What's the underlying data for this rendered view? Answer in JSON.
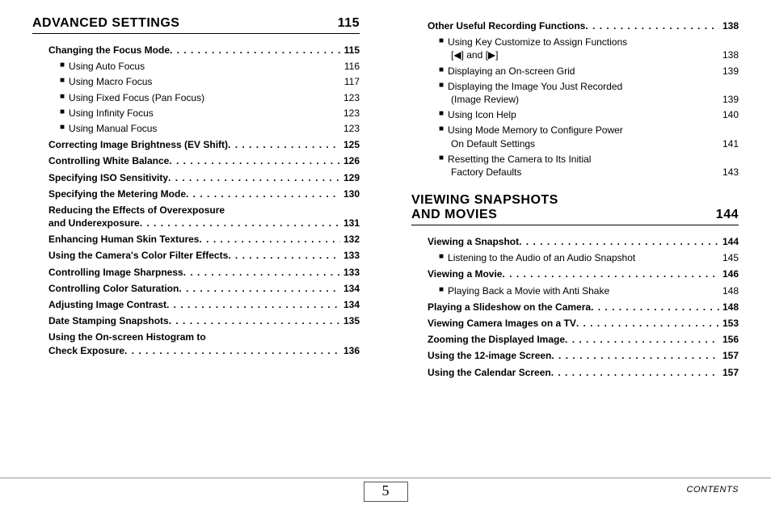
{
  "footer": {
    "page": "5",
    "label": "CONTENTS"
  },
  "left": {
    "heading": "ADVANCED SETTINGS",
    "heading_page": "115",
    "items": [
      {
        "t": 1,
        "title": "Changing the Focus Mode",
        "pg": "115"
      },
      {
        "t": 2,
        "title": "Using Auto Focus",
        "pg": "116"
      },
      {
        "t": 2,
        "title": "Using Macro Focus",
        "pg": "117"
      },
      {
        "t": 2,
        "title": "Using Fixed Focus (Pan Focus)",
        "pg": "123"
      },
      {
        "t": 2,
        "title": "Using Infinity Focus",
        "pg": "123"
      },
      {
        "t": 2,
        "title": "Using Manual Focus",
        "pg": "123"
      },
      {
        "t": 1,
        "title": "Correcting Image Brightness (EV Shift)",
        "pg": "125"
      },
      {
        "t": 1,
        "title": "Controlling White Balance",
        "pg": "126"
      },
      {
        "t": 1,
        "title": "Specifying ISO Sensitivity",
        "pg": "129"
      },
      {
        "t": 1,
        "title": "Specifying the Metering Mode",
        "pg": "130"
      },
      {
        "t": 1,
        "wrap": true,
        "title1": "Reducing the Effects of Overexposure",
        "title2": "and Underexposure",
        "pg": "131"
      },
      {
        "t": 1,
        "title": "Enhancing Human Skin Textures",
        "pg": "132"
      },
      {
        "t": 1,
        "title": "Using the Camera's Color Filter Effects",
        "pg": "133"
      },
      {
        "t": 1,
        "title": "Controlling Image Sharpness",
        "pg": "133"
      },
      {
        "t": 1,
        "title": "Controlling Color Saturation",
        "pg": "134"
      },
      {
        "t": 1,
        "title": "Adjusting Image Contrast",
        "pg": "134"
      },
      {
        "t": 1,
        "title": "Date Stamping Snapshots",
        "pg": "135"
      },
      {
        "t": 1,
        "wrap": true,
        "title1": "Using the On-screen Histogram to",
        "title2": "Check Exposure",
        "pg": "136"
      }
    ]
  },
  "right_top": {
    "items": [
      {
        "t": 1,
        "title": "Other Useful Recording Functions",
        "pg": "138"
      },
      {
        "t": 2,
        "wrap": true,
        "title1": "Using Key Customize to Assign Functions",
        "title2": "[◀] and [▶]",
        "pg": "138"
      },
      {
        "t": 2,
        "title": "Displaying an On-screen Grid",
        "pg": "139"
      },
      {
        "t": 2,
        "wrap": true,
        "title1": "Displaying the Image You Just Recorded",
        "title2": "(Image Review)",
        "pg": "139"
      },
      {
        "t": 2,
        "title": "Using Icon Help",
        "pg": "140"
      },
      {
        "t": 2,
        "wrap": true,
        "title1": "Using Mode Memory to Configure Power",
        "title2": "On Default Settings",
        "pg": "141"
      },
      {
        "t": 2,
        "wrap": true,
        "title1": "Resetting the Camera to Its Initial",
        "title2": "Factory Defaults",
        "pg": "143"
      }
    ]
  },
  "right_section": {
    "heading1": "VIEWING SNAPSHOTS",
    "heading2": "AND MOVIES",
    "heading_page": "144",
    "items": [
      {
        "t": 1,
        "title": "Viewing a Snapshot",
        "pg": "144"
      },
      {
        "t": 2,
        "title": "Listening to the Audio of an Audio Snapshot",
        "pg": "145"
      },
      {
        "t": 1,
        "title": "Viewing a Movie",
        "pg": "146"
      },
      {
        "t": 2,
        "title": "Playing Back a Movie with Anti Shake",
        "pg": "148"
      },
      {
        "t": 1,
        "title": "Playing a Slideshow on the Camera",
        "pg": "148"
      },
      {
        "t": 1,
        "title": "Viewing Camera Images on a TV",
        "pg": "153"
      },
      {
        "t": 1,
        "title": "Zooming the Displayed Image",
        "pg": "156"
      },
      {
        "t": 1,
        "title": "Using the 12-image Screen",
        "pg": "157"
      },
      {
        "t": 1,
        "title": "Using the Calendar Screen",
        "pg": "157"
      }
    ]
  }
}
